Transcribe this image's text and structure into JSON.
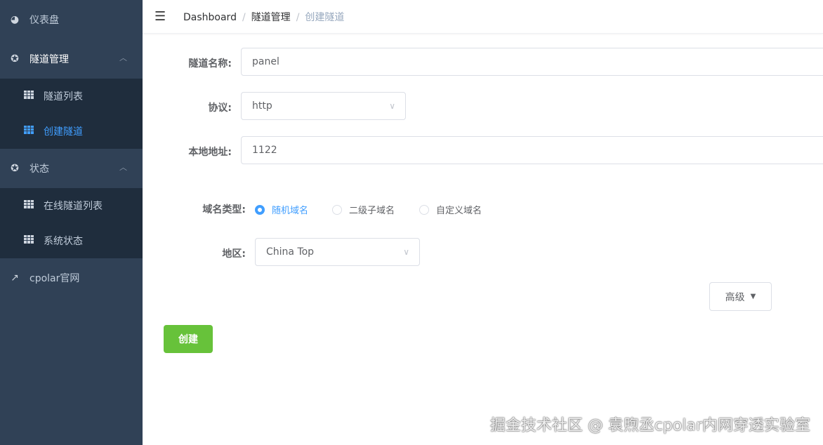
{
  "sidebar": {
    "items": [
      {
        "label": "仪表盘",
        "icon": "dashboard-icon"
      },
      {
        "label": "隧道管理",
        "icon": "lifebuoy-icon",
        "expanded": true,
        "children": [
          {
            "label": "隧道列表"
          },
          {
            "label": "创建隧道",
            "active": true
          }
        ]
      },
      {
        "label": "状态",
        "icon": "lifebuoy-icon",
        "expanded": true,
        "children": [
          {
            "label": "在线隧道列表"
          },
          {
            "label": "系统状态"
          }
        ]
      },
      {
        "label": "cpolar官网",
        "icon": "external-link-icon"
      }
    ]
  },
  "breadcrumb": [
    "Dashboard",
    "隧道管理",
    "创建隧道"
  ],
  "form": {
    "name_label": "隧道名称:",
    "name_value": "panel",
    "protocol_label": "协议:",
    "protocol_value": "http",
    "local_label": "本地地址:",
    "local_value": "1122",
    "domain_label": "域名类型:",
    "domain_options": [
      "随机域名",
      "二级子域名",
      "自定义域名"
    ],
    "domain_selected": "随机域名",
    "region_label": "地区:",
    "region_value": "China Top",
    "advanced_label": "高级",
    "create_label": "创建"
  },
  "accent": "#409eff",
  "success": "#67c23a",
  "watermark": "掘金技术社区 @ 袁煦丞cpolar内网穿透实验室"
}
